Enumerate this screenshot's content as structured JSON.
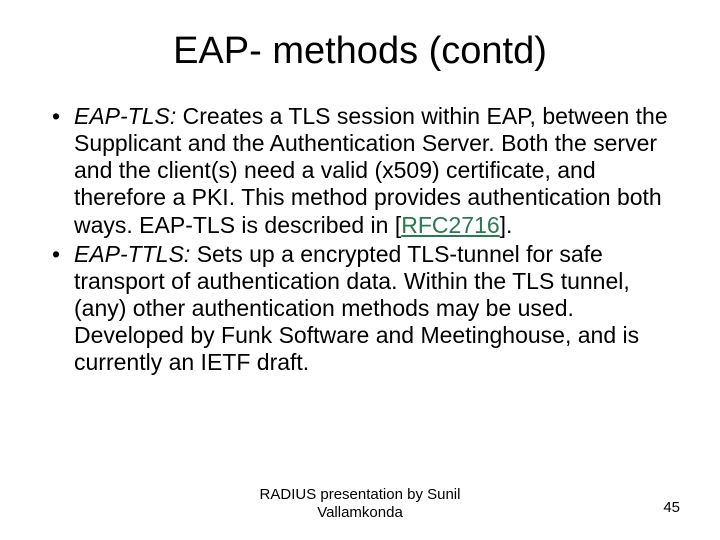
{
  "title": "EAP- methods (contd)",
  "bullets": [
    {
      "label": "EAP-TLS:",
      "pre": " Creates a TLS session within EAP, between the Supplicant and the Authentication Server. Both the server and the client(s) need a valid (x509) certificate, and therefore a PKI. This method provides authentication both ways. EAP-TLS is described in [",
      "link": "RFC2716",
      "post": "]."
    },
    {
      "label": "EAP-TTLS:",
      "pre": " Sets up a encrypted TLS-tunnel for safe transport of authentication data. Within the TLS tunnel, (any) other authentication methods may be used. Developed by Funk Software and Meetinghouse, and is currently an IETF draft.",
      "link": "",
      "post": ""
    }
  ],
  "footer_line1": "RADIUS presentation by Sunil",
  "footer_line2": "Vallamkonda",
  "page": "45"
}
